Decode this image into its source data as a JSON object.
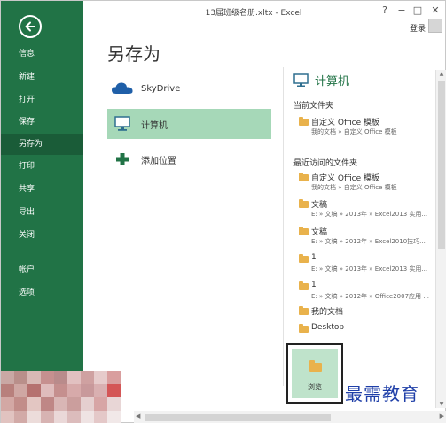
{
  "window": {
    "title": "13届班级名册.xltx - Excel",
    "help": "?",
    "minimize": "−",
    "restore": "□",
    "close": "✕",
    "login": "登录"
  },
  "sidebar": {
    "items": [
      {
        "label": "信息"
      },
      {
        "label": "新建"
      },
      {
        "label": "打开"
      },
      {
        "label": "保存"
      },
      {
        "label": "另存为",
        "active": true
      },
      {
        "label": "打印"
      },
      {
        "label": "共享"
      },
      {
        "label": "导出"
      },
      {
        "label": "关闭"
      },
      {
        "label": "帐户"
      },
      {
        "label": "选项"
      }
    ]
  },
  "main": {
    "heading": "另存为",
    "places": [
      {
        "label": "SkyDrive",
        "icon": "cloud-icon"
      },
      {
        "label": "计算机",
        "icon": "computer-icon",
        "selected": true
      },
      {
        "label": "添加位置",
        "icon": "plus-icon"
      }
    ]
  },
  "right": {
    "heading": "计算机",
    "current_title": "当前文件夹",
    "current": {
      "name": "自定义 Office 模板",
      "path": "我的文档 » 自定义 Office 模板"
    },
    "recent_title": "最近访问的文件夹",
    "recent": [
      {
        "name": "自定义 Office 模板",
        "path": "我的文档 » 自定义 Office 模板"
      },
      {
        "name": "文稿",
        "path": "E: » 文稿 » 2013年 » Excel2013 实用..."
      },
      {
        "name": "文稿",
        "path": "E: » 文稿 » 2012年 » Excel2010技巧..."
      },
      {
        "name": "1",
        "path": "E: » 文稿 » 2013年 » Excel2013 实用..."
      },
      {
        "name": "1",
        "path": "E: » 文稿 » 2012年 » Office2007应用 ..."
      },
      {
        "name": "我的文档",
        "path": ""
      },
      {
        "name": "Desktop",
        "path": ""
      }
    ],
    "browse_label": "浏览"
  },
  "watermark": "最需教育",
  "colors": {
    "accent": "#217346",
    "selected_place": "#a6d8b8",
    "folder": "#e9b24c"
  }
}
